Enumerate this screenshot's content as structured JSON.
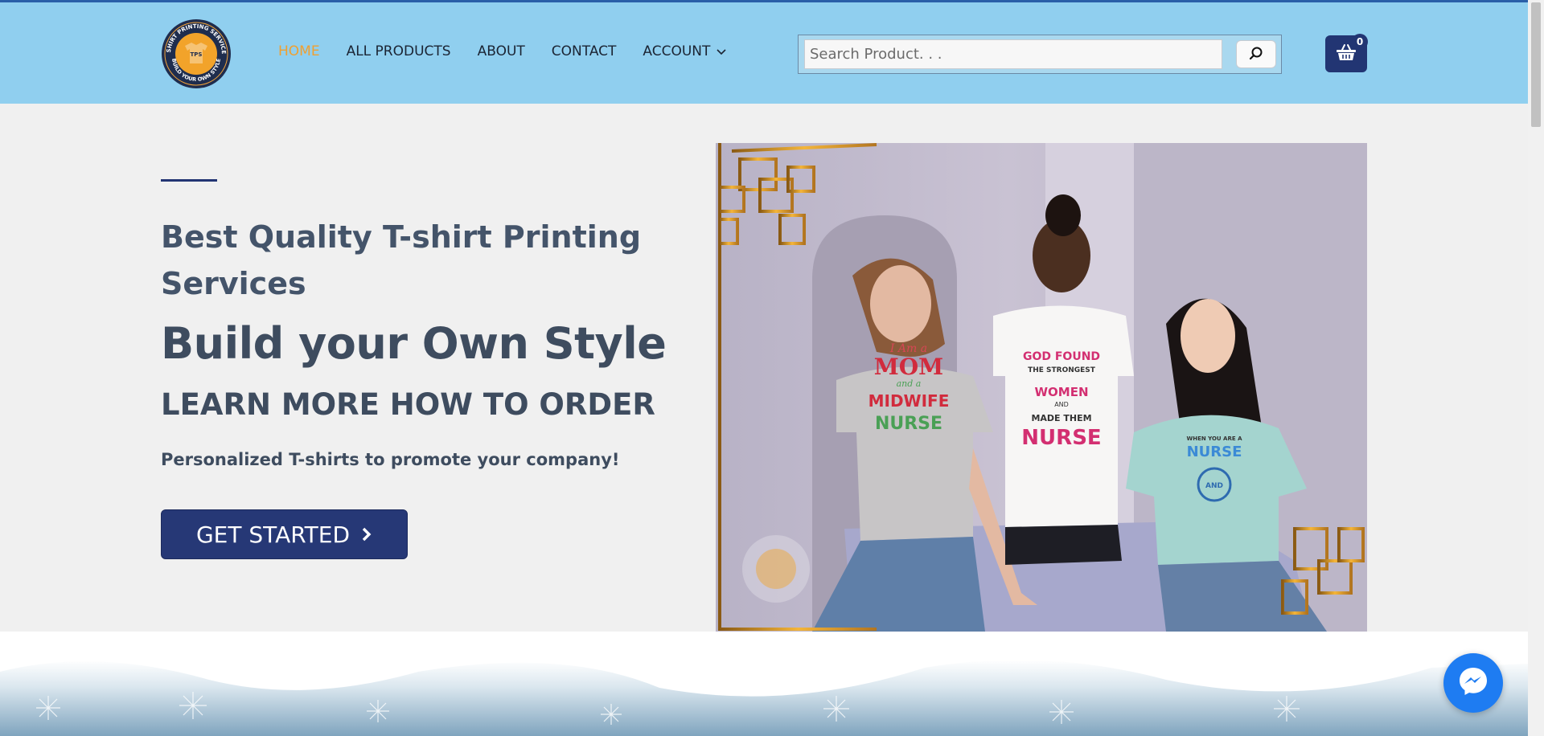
{
  "brand": {
    "logo_text_top": "T-SHIRT PRINTING SERVICES",
    "logo_text_bottom": "BUILD YOUR OWN STYLE",
    "logo_center": "TPS"
  },
  "nav": {
    "items": [
      {
        "label": "HOME",
        "active": true
      },
      {
        "label": "ALL PRODUCTS",
        "active": false
      },
      {
        "label": "ABOUT",
        "active": false
      },
      {
        "label": "CONTACT",
        "active": false
      },
      {
        "label": "ACCOUNT",
        "active": false,
        "has_dropdown": true
      }
    ]
  },
  "search": {
    "placeholder": "Search Product. . .",
    "icon": "search-icon"
  },
  "cart": {
    "count": "0",
    "icon": "basket-icon"
  },
  "hero": {
    "subtitle": "Best Quality T-shirt Printing Services",
    "title": "Build your Own Style",
    "learn_more": "LEARN MORE HOW TO ORDER",
    "description": "Personalized T-shirts to promote your company!",
    "cta_label": "GET STARTED",
    "image_shirts": {
      "left_line1": "I Am a",
      "left_line2": "MOM",
      "left_line3": "and a",
      "left_line4": "MIDWIFE",
      "left_line5": "NURSE",
      "middle_line1": "GOD FOUND",
      "middle_line2": "THE STRONGEST",
      "middle_line3": "WOMEN",
      "middle_line4": "AND",
      "middle_line5": "MADE THEM",
      "middle_line6": "NURSE",
      "right_line1": "WHEN YOU ARE A",
      "right_line2": "NURSE",
      "right_line3": "AND"
    }
  },
  "colors": {
    "header_bg": "#90cfef",
    "accent": "#f0a030",
    "primary": "#223573",
    "text": "#3e4c5f"
  },
  "chat": {
    "icon": "messenger-icon"
  }
}
